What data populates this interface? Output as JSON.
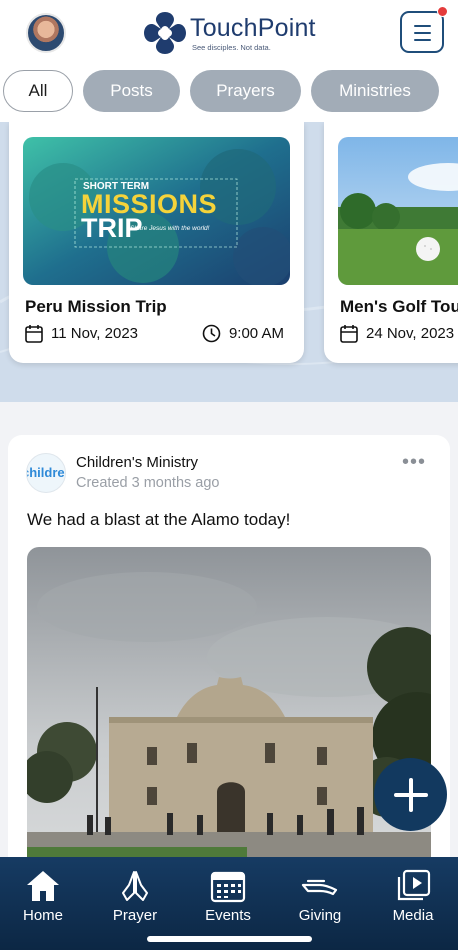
{
  "header": {
    "brand_name": "TouchPoint",
    "brand_tagline": "See disciples. Not data."
  },
  "filters": {
    "tabs": [
      {
        "label": "All",
        "active": true
      },
      {
        "label": "Posts",
        "active": false
      },
      {
        "label": "Prayers",
        "active": false
      },
      {
        "label": "Ministries",
        "active": false
      }
    ]
  },
  "events": [
    {
      "title": "Peru Mission Trip",
      "date": "11 Nov, 2023",
      "time": "9:00 AM",
      "banner": {
        "line1": "SHORT TERM",
        "line2": "MISSIONS",
        "line3": "TRIP",
        "script": "Share Jesus with the world!"
      }
    },
    {
      "title": "Men's Golf Tou",
      "date": "24 Nov, 2023"
    }
  ],
  "post": {
    "ministry_logo_text": "childre",
    "ministry_name": "Children's Ministry",
    "meta": "Created 3 months ago",
    "more_label": "•••",
    "text": "We had a blast at the Alamo today!"
  },
  "bottom_nav": {
    "items": [
      {
        "label": "Home",
        "icon": "home-icon"
      },
      {
        "label": "Prayer",
        "icon": "praying-hands-icon"
      },
      {
        "label": "Events",
        "icon": "calendar-icon"
      },
      {
        "label": "Giving",
        "icon": "giving-hand-icon"
      },
      {
        "label": "Media",
        "icon": "media-play-icon"
      }
    ]
  },
  "colors": {
    "brand_navy": "#1f3c6e",
    "nav_bg": "#163b63",
    "fab": "#12395f",
    "chip_inactive": "#a2acb7",
    "notification_dot": "#e43b3b",
    "mission_yellow": "#f5d33a"
  }
}
